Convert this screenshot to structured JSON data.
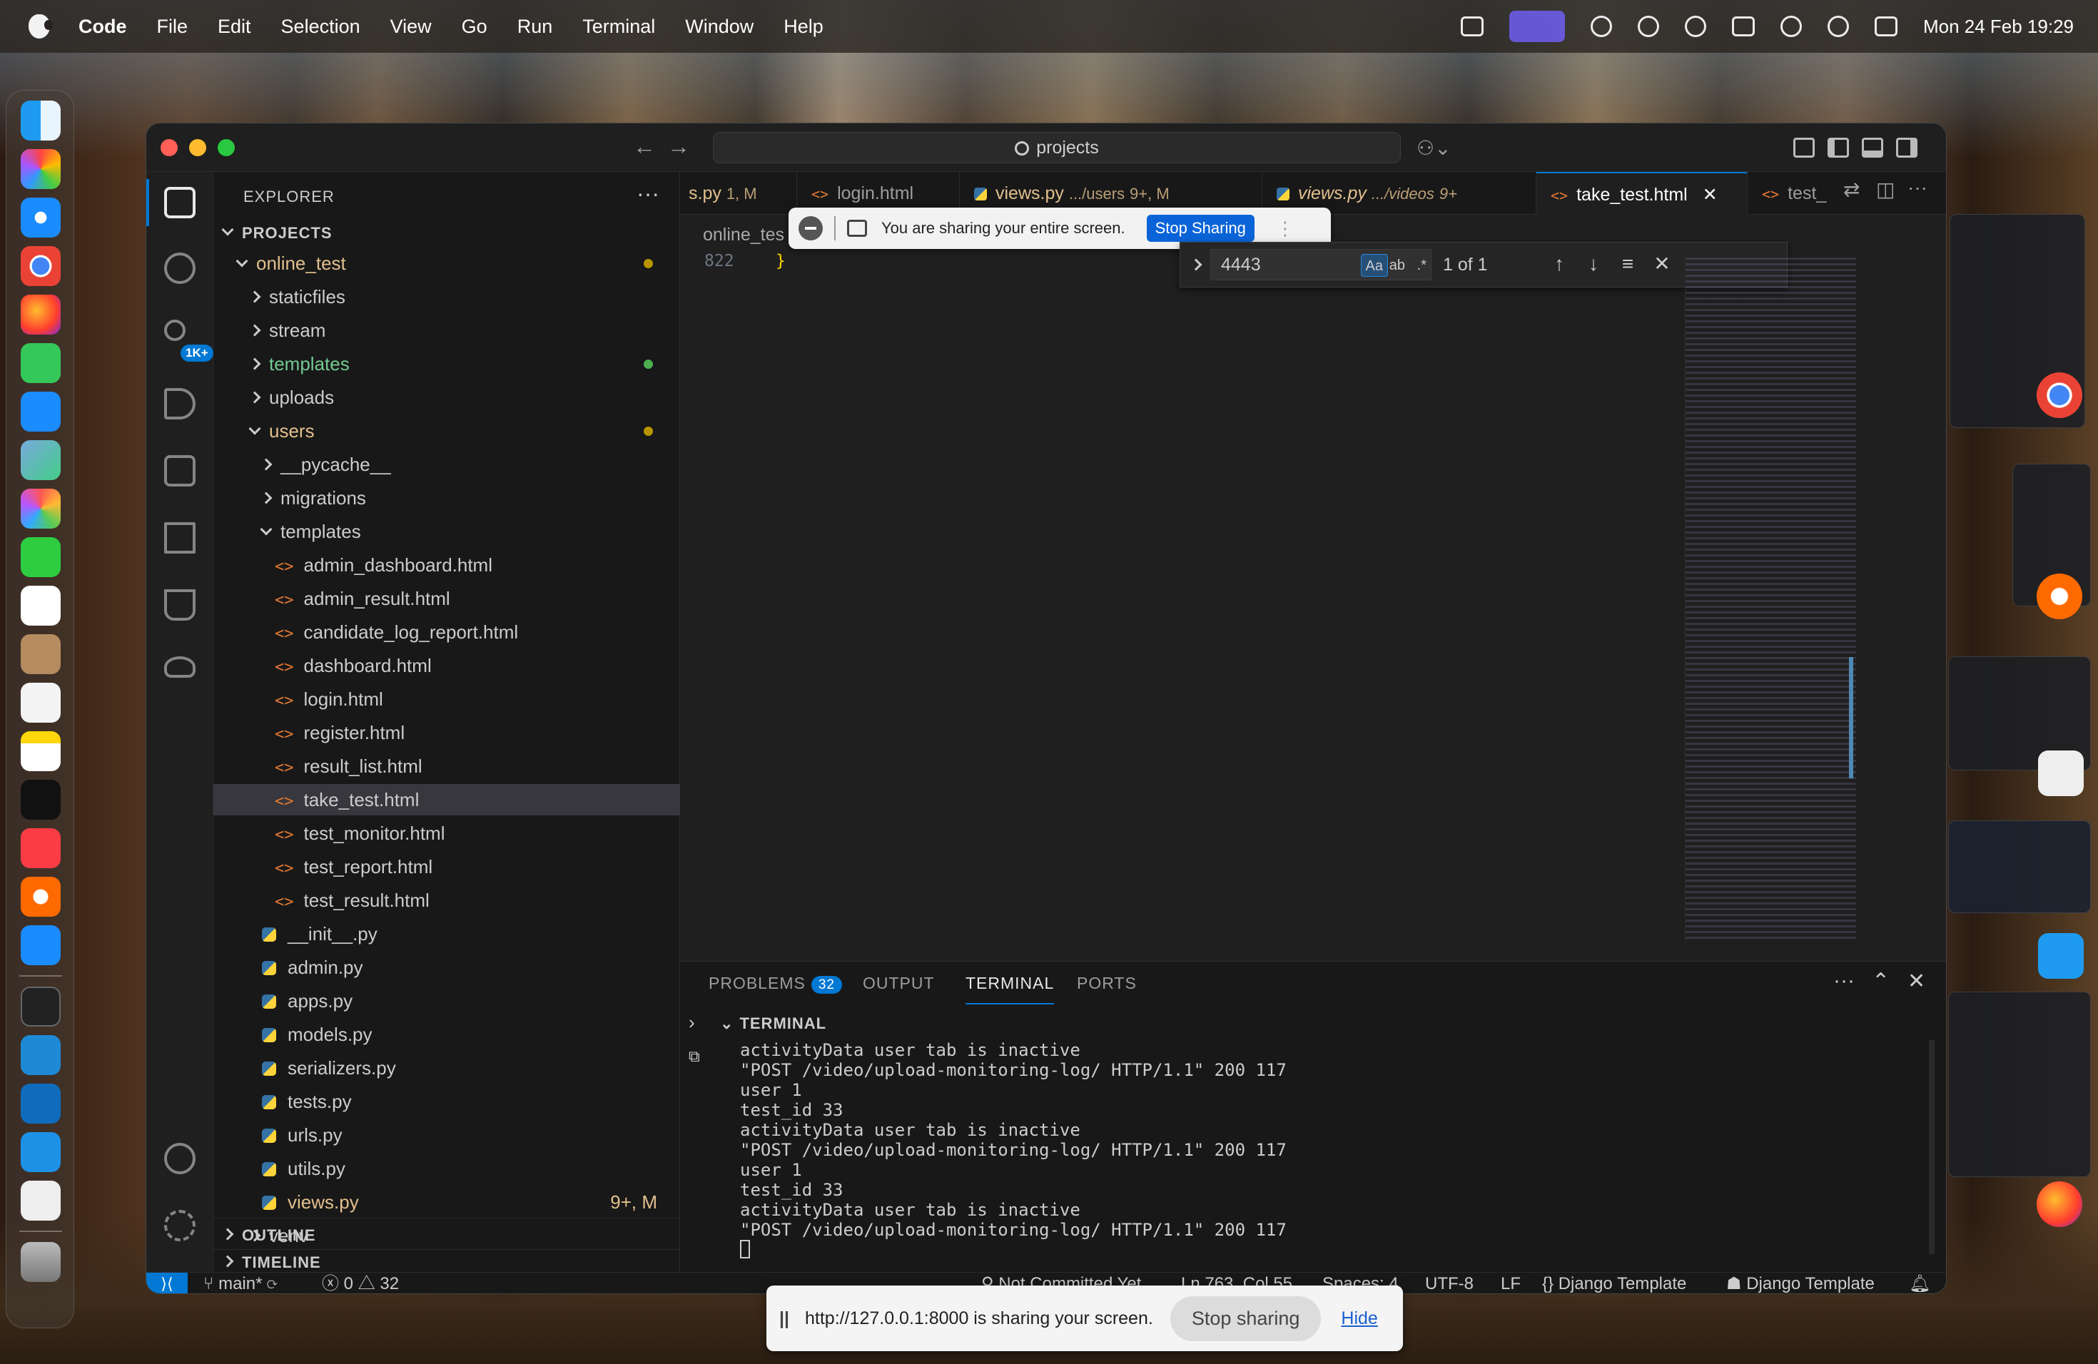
{
  "menubar": {
    "app": "Code",
    "items": [
      "File",
      "Edit",
      "Selection",
      "View",
      "Go",
      "Run",
      "Terminal",
      "Window",
      "Help"
    ],
    "clock": "Mon 24 Feb  19:29"
  },
  "window": {
    "command_center": "projects",
    "tabs": [
      {
        "name": "s.py",
        "badge": "1, M",
        "kind": "py"
      },
      {
        "name": "login.html",
        "kind": "html"
      },
      {
        "name": "views.py",
        "path": ".../users",
        "badge": "9+, M",
        "kind": "py"
      },
      {
        "name": "views.py",
        "path": ".../videos",
        "badge": "9+",
        "kind": "py",
        "italic": true
      },
      {
        "name": "take_test.html",
        "kind": "html",
        "active": true
      },
      {
        "name": "test_",
        "kind": "html"
      }
    ]
  },
  "explorer": {
    "header": "EXPLORER",
    "section": "PROJECTS",
    "rows": [
      {
        "label": "online_test",
        "depth": 1,
        "type": "folder-open",
        "color": "mod",
        "dot": "#b89500"
      },
      {
        "label": "staticfiles",
        "depth": 2,
        "type": "folder"
      },
      {
        "label": "stream",
        "depth": 2,
        "type": "folder"
      },
      {
        "label": "templates",
        "depth": 2,
        "type": "folder",
        "color": "grn",
        "dot": "#4caf50"
      },
      {
        "label": "uploads",
        "depth": 2,
        "type": "folder"
      },
      {
        "label": "users",
        "depth": 2,
        "type": "folder-open",
        "color": "mod",
        "dot": "#b89500"
      },
      {
        "label": "__pycache__",
        "depth": 3,
        "type": "folder"
      },
      {
        "label": "migrations",
        "depth": 3,
        "type": "folder"
      },
      {
        "label": "templates",
        "depth": 3,
        "type": "folder-open"
      },
      {
        "label": "admin_dashboard.html",
        "depth": 4,
        "type": "html"
      },
      {
        "label": "admin_result.html",
        "depth": 4,
        "type": "html"
      },
      {
        "label": "candidate_log_report.html",
        "depth": 4,
        "type": "html"
      },
      {
        "label": "dashboard.html",
        "depth": 4,
        "type": "html"
      },
      {
        "label": "login.html",
        "depth": 4,
        "type": "html"
      },
      {
        "label": "register.html",
        "depth": 4,
        "type": "html"
      },
      {
        "label": "result_list.html",
        "depth": 4,
        "type": "html"
      },
      {
        "label": "take_test.html",
        "depth": 4,
        "type": "html",
        "selected": true
      },
      {
        "label": "test_monitor.html",
        "depth": 4,
        "type": "html"
      },
      {
        "label": "test_report.html",
        "depth": 4,
        "type": "html"
      },
      {
        "label": "test_result.html",
        "depth": 4,
        "type": "html"
      },
      {
        "label": "__init__.py",
        "depth": 3,
        "type": "py"
      },
      {
        "label": "admin.py",
        "depth": 3,
        "type": "py"
      },
      {
        "label": "apps.py",
        "depth": 3,
        "type": "py"
      },
      {
        "label": "models.py",
        "depth": 3,
        "type": "py"
      },
      {
        "label": "serializers.py",
        "depth": 3,
        "type": "py"
      },
      {
        "label": "tests.py",
        "depth": 3,
        "type": "py"
      },
      {
        "label": "urls.py",
        "depth": 3,
        "type": "py"
      },
      {
        "label": "utils.py",
        "depth": 3,
        "type": "py"
      },
      {
        "label": "views.py",
        "depth": 3,
        "type": "py",
        "color": "mod",
        "tag": "9+, M"
      },
      {
        "label": "venv",
        "depth": 2,
        "type": "folder"
      }
    ],
    "outline": "OUTLINE",
    "timeline": "TIMELINE"
  },
  "activity": {
    "scm_badge": "1K+"
  },
  "editor": {
    "breadcrumb": "online_tes",
    "line_number": "822",
    "line_text": "}",
    "share_banner": {
      "text": "You are sharing your entire screen.",
      "button": "Stop Sharing"
    },
    "find": {
      "query": "4443",
      "match_case": "Aa",
      "whole_word": "ab",
      "regex": ".*",
      "count": "1 of 1"
    }
  },
  "panel": {
    "tabs": [
      "PROBLEMS",
      "OUTPUT",
      "TERMINAL",
      "PORTS"
    ],
    "problems_count": "32",
    "terminal_title": "TERMINAL",
    "lines": [
      "activityData user tab is inactive",
      "\"POST /video/upload-monitoring-log/ HTTP/1.1\" 200 117",
      "user 1",
      "test_id 33",
      "activityData user tab is inactive",
      "\"POST /video/upload-monitoring-log/ HTTP/1.1\" 200 117",
      "user 1",
      "test_id 33",
      "activityData user tab is inactive",
      "\"POST /video/upload-monitoring-log/ HTTP/1.1\" 200 117"
    ]
  },
  "status": {
    "branch": "main*",
    "errors": "0",
    "warnings": "32",
    "git": "Not Committed Yet",
    "position": "Ln 763, Col 55",
    "spaces": "Spaces: 4",
    "encoding": "UTF-8",
    "eol": "LF",
    "language": "Django Template",
    "language2": "Django Template"
  },
  "screen_share_bar": {
    "text": "http://127.0.0.1:8000 is sharing your screen.",
    "stop": "Stop sharing",
    "hide": "Hide"
  },
  "colors": {
    "accent": "#0078d4",
    "modified": "#e2c08d",
    "added": "#73c991",
    "html_icon": "#e37933"
  }
}
